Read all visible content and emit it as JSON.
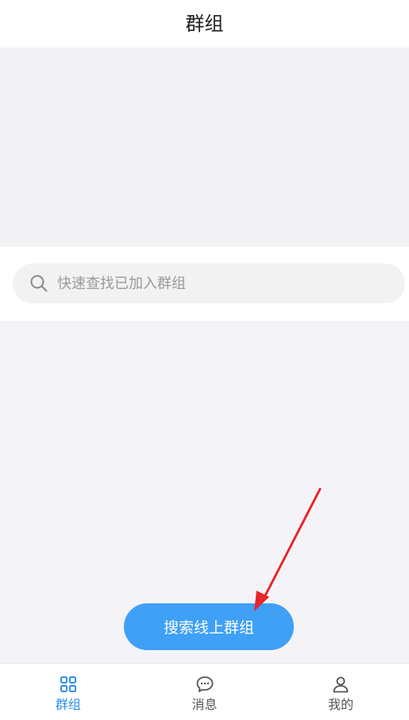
{
  "header": {
    "title": "群组"
  },
  "search": {
    "placeholder": "快速查找已加入群组",
    "value": "",
    "icon": "search-icon"
  },
  "main": {
    "search_online_label": "搜索线上群组"
  },
  "tabbar": {
    "items": [
      {
        "label": "群组",
        "icon": "grid-icon",
        "active": true
      },
      {
        "label": "消息",
        "icon": "chat-bubble-icon",
        "active": false
      },
      {
        "label": "我的",
        "icon": "user-icon",
        "active": false
      }
    ]
  },
  "colors": {
    "accent": "#2f8ff0",
    "button": "#3fa0f6",
    "annotation_arrow": "#e8262b"
  }
}
